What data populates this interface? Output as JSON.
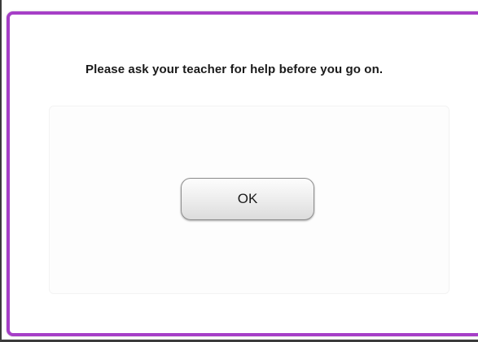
{
  "dialog": {
    "message": "Please ask your teacher for help before you go on.",
    "ok_label": "OK",
    "border_color": "#a63fc7"
  }
}
